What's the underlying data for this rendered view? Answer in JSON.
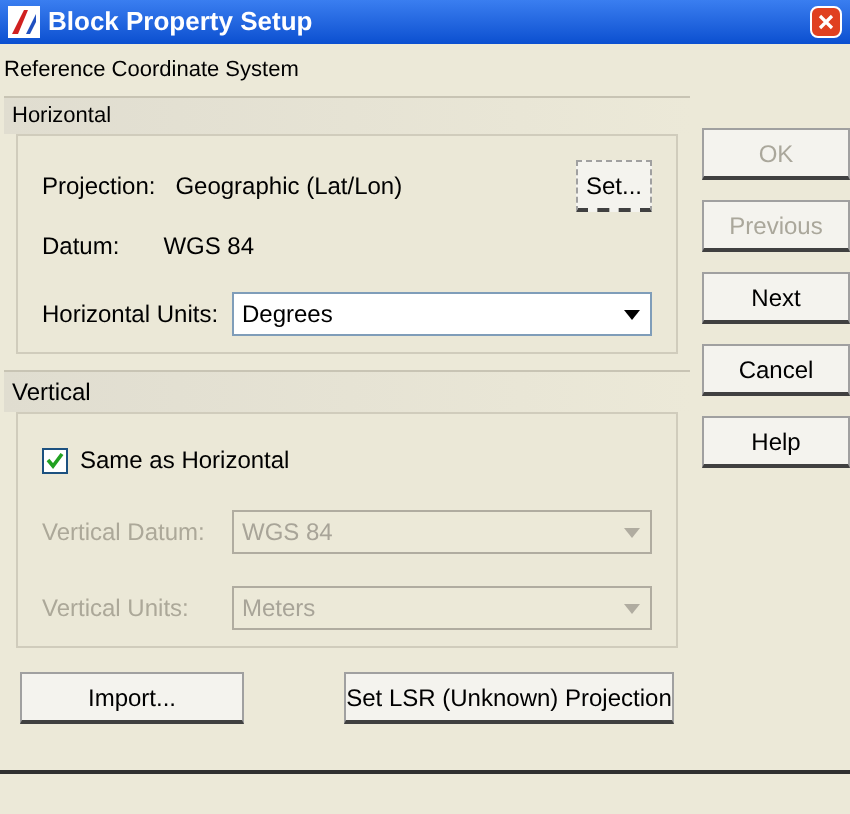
{
  "window": {
    "title": "Block Property Setup"
  },
  "section_label": "Reference Coordinate System",
  "horizontal": {
    "title": "Horizontal",
    "projection_label": "Projection:",
    "projection_value": "Geographic (Lat/Lon)",
    "set_button": "Set...",
    "datum_label": "Datum:",
    "datum_value": "WGS 84",
    "units_label": "Horizontal Units:",
    "units_value": "Degrees"
  },
  "vertical": {
    "title": "Vertical",
    "same_checkbox": {
      "label": "Same as Horizontal",
      "checked": true
    },
    "fields": [
      {
        "label": "Vertical Datum:",
        "value": "WGS 84",
        "disabled": true
      },
      {
        "label": "Vertical Units:",
        "value": "Meters",
        "disabled": true
      }
    ]
  },
  "bottom_buttons": [
    "Import...",
    "Set LSR (Unknown) Projection"
  ],
  "side_buttons": [
    {
      "label": "OK",
      "disabled": true
    },
    {
      "label": "Previous",
      "disabled": true
    },
    {
      "label": "Next",
      "disabled": false
    },
    {
      "label": "Cancel",
      "disabled": false
    },
    {
      "label": "Help",
      "disabled": false
    }
  ]
}
